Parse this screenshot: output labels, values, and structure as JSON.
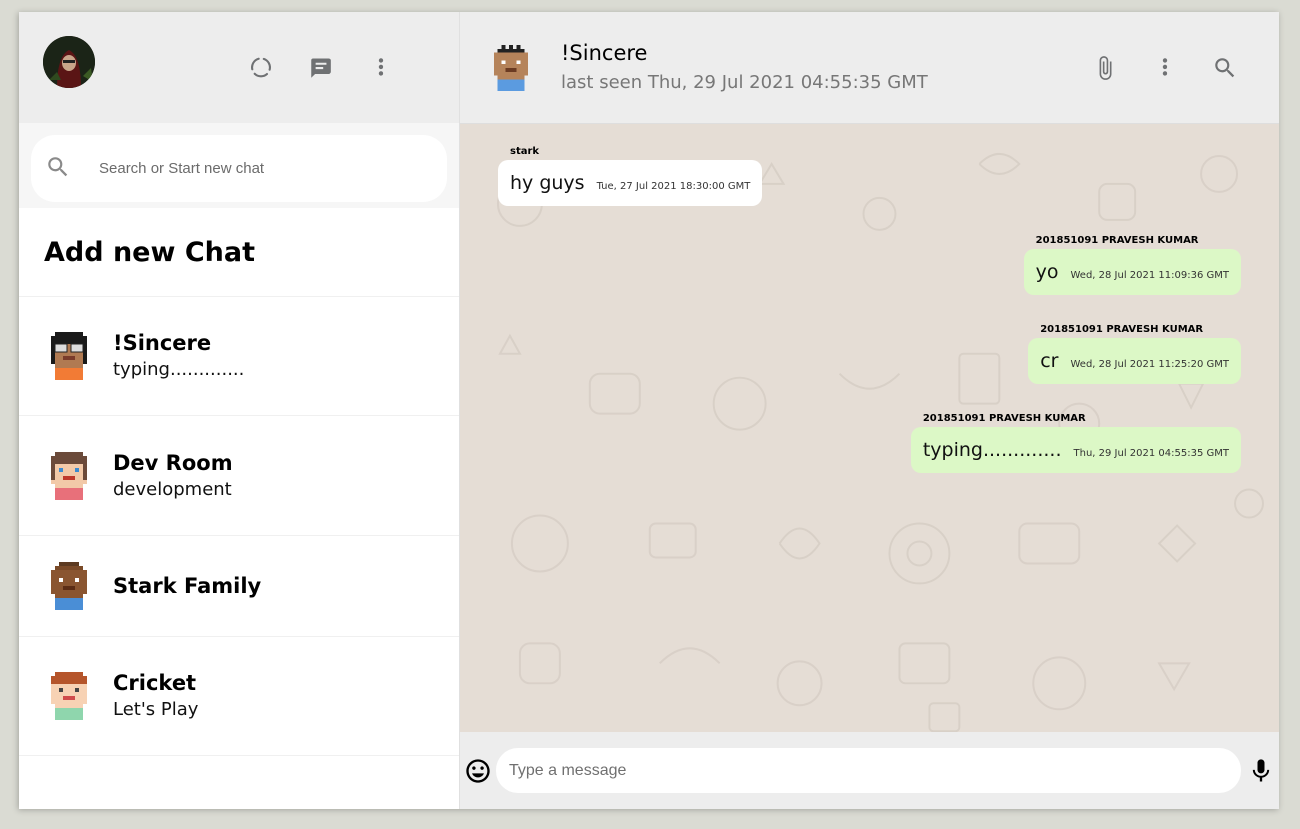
{
  "sidebar": {
    "search_placeholder": "Search or Start new chat",
    "add_chat_label": "Add new Chat",
    "chats": [
      {
        "name": "!Sincere",
        "last": "typing............."
      },
      {
        "name": "Dev Room",
        "last": "development"
      },
      {
        "name": "Stark Family",
        "last": ""
      },
      {
        "name": "Cricket",
        "last": "Let's Play"
      }
    ]
  },
  "header": {
    "name": "!Sincere",
    "last_seen": "last seen Thu, 29 Jul 2021 04:55:35 GMT"
  },
  "messages": [
    {
      "sender": "stark",
      "text": "hy guys",
      "time": "Tue, 27 Jul 2021 18:30:00 GMT",
      "mine": false
    },
    {
      "sender": "201851091 PRAVESH KUMAR",
      "text": "yo",
      "time": "Wed, 28 Jul 2021 11:09:36 GMT",
      "mine": true
    },
    {
      "sender": "201851091 PRAVESH KUMAR",
      "text": "cr",
      "time": "Wed, 28 Jul 2021 11:25:20 GMT",
      "mine": true
    },
    {
      "sender": "201851091 PRAVESH KUMAR",
      "text": "typing.............",
      "time": "Thu, 29 Jul 2021 04:55:35 GMT",
      "mine": true
    }
  ],
  "footer": {
    "placeholder": "Type a message"
  },
  "icons": {
    "status": "status-icon",
    "new_chat": "chat-icon",
    "menu": "more-vert-icon",
    "search": "search-icon",
    "attach": "paperclip-icon",
    "emoji": "emoji-icon",
    "mic": "mic-icon"
  },
  "colors": {
    "panel_bg": "#ededed",
    "chat_bg": "#e5ddd5",
    "outgoing_bubble": "#dcf8c6",
    "incoming_bubble": "#ffffff"
  }
}
